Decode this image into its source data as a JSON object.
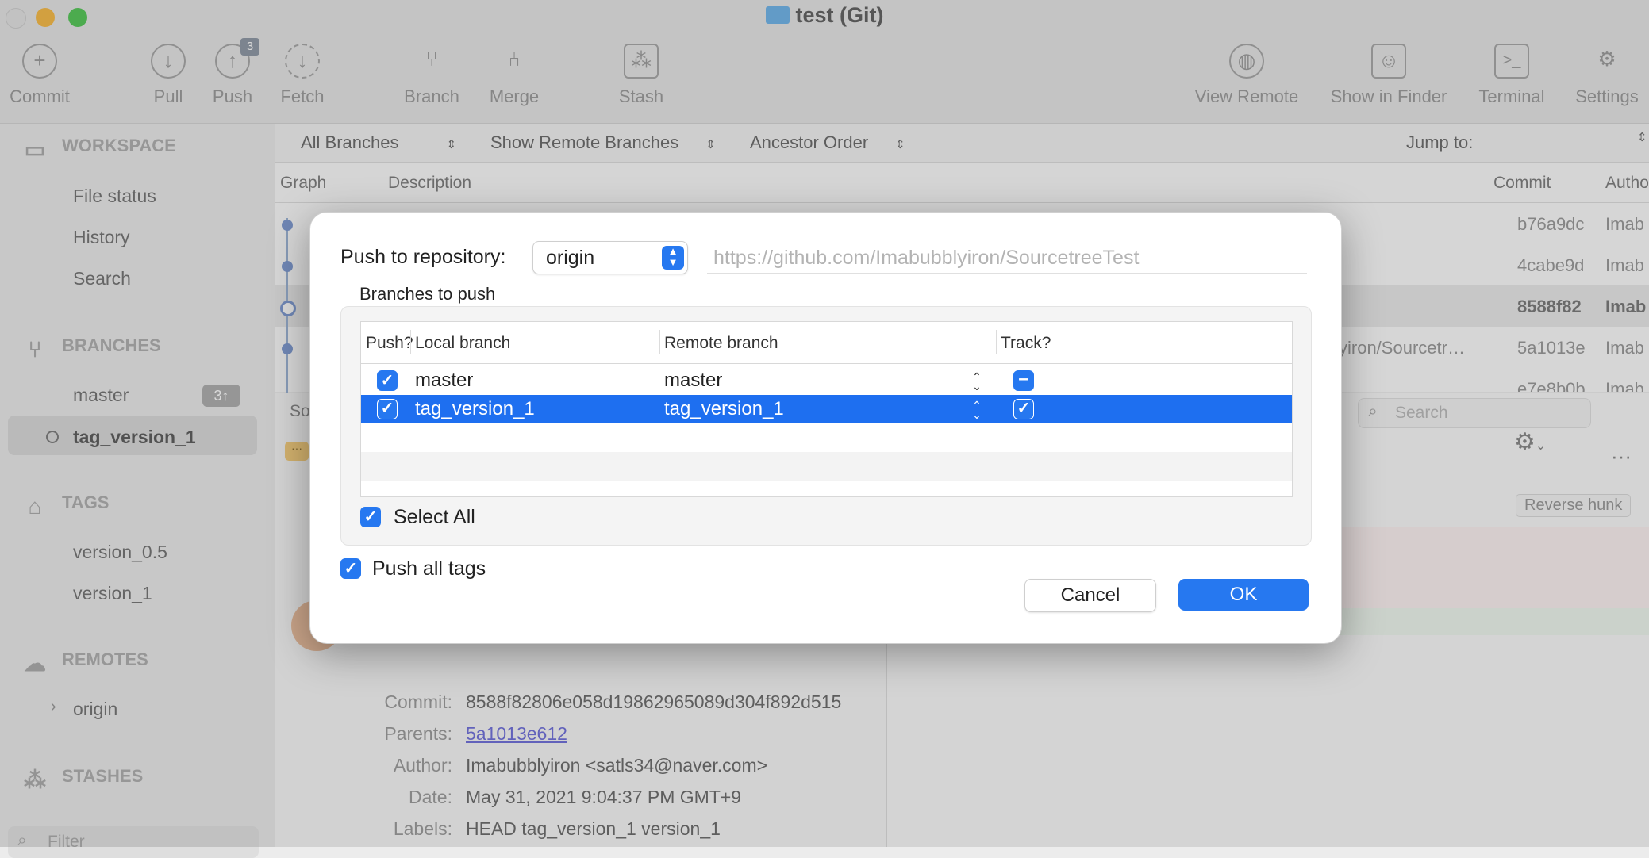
{
  "window": {
    "title": "test (Git)"
  },
  "toolbar": {
    "commit": "Commit",
    "pull": "Pull",
    "push": "Push",
    "push_badge": "3",
    "fetch": "Fetch",
    "branch": "Branch",
    "merge": "Merge",
    "stash": "Stash",
    "view_remote": "View Remote",
    "show_in_finder": "Show in Finder",
    "terminal": "Terminal",
    "settings": "Settings"
  },
  "sidebar": {
    "workspace": "WORKSPACE",
    "workspace_items": [
      "File status",
      "History",
      "Search"
    ],
    "branches": "BRANCHES",
    "branch_items": [
      "master",
      "tag_version_1"
    ],
    "ahead_badge": "3↑",
    "tags": "TAGS",
    "tag_items": [
      "version_0.5",
      "version_1"
    ],
    "remotes": "REMOTES",
    "remote_items": [
      "origin"
    ],
    "stashes": "STASHES",
    "filter_placeholder": "Filter"
  },
  "filterbar": {
    "branches": "All Branches",
    "remote": "Show Remote Branches",
    "order": "Ancestor Order",
    "jump_to": "Jump to:"
  },
  "columns": {
    "graph": "Graph",
    "description": "Description",
    "commit": "Commit",
    "author": "Autho"
  },
  "commits": [
    {
      "hash": "b76a9dc",
      "author": "Imab"
    },
    {
      "hash": "4cabe9d",
      "author": "Imab"
    },
    {
      "hash": "8588f82",
      "author": "Imab"
    },
    {
      "hash": "5a1013e",
      "author": "Imab",
      "desc_tail": "yiron/Sourcetr…"
    },
    {
      "hash": "e7e8b0b",
      "author": "Imab"
    }
  ],
  "lower": {
    "search_placeholder": "Search",
    "reverse_hunk": "Reverse hunk",
    "sort_label": "So",
    "info": {
      "commit_label": "Commit:",
      "commit": "8588f82806e058d19862965089d304f892d515",
      "parents_label": "Parents:",
      "parents": "5a1013e612",
      "author_label": "Author:",
      "author": "Imabubblyiron <satls34@naver.com>",
      "date_label": "Date:",
      "date": "May 31, 2021 9:04:37 PM GMT+9",
      "labels_label": "Labels:",
      "labels": "HEAD tag_version_1 version_1"
    }
  },
  "dialog": {
    "repo_label": "Push to repository:",
    "repo_value": "origin",
    "url": "https://github.com/Imabubblyiron/SourcetreeTest",
    "group_label": "Branches to push",
    "headers": {
      "push": "Push?",
      "local": "Local branch",
      "remote": "Remote branch",
      "track": "Track?"
    },
    "rows": [
      {
        "local": "master",
        "remote": "master",
        "push": true,
        "track": "mixed"
      },
      {
        "local": "tag_version_1",
        "remote": "tag_version_1",
        "push": true,
        "track": true
      }
    ],
    "select_all": "Select All",
    "push_all_tags": "Push all tags",
    "cancel": "Cancel",
    "ok": "OK"
  },
  "colors": {
    "accent": "#2678f0",
    "selection": "#1e6ff0"
  }
}
